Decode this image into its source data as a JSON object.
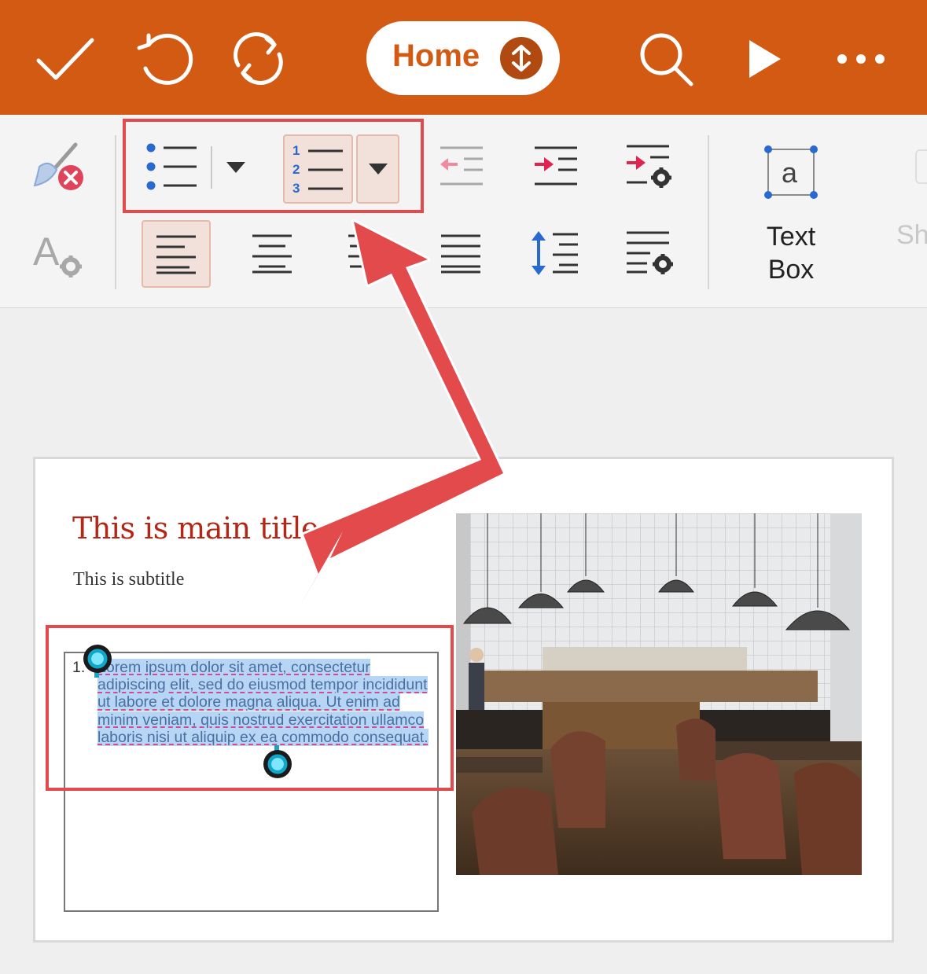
{
  "appbar": {
    "tab_label": "Home",
    "icons": [
      "checkmark-icon",
      "undo-icon",
      "redo-icon",
      "up-down-toggle-icon",
      "search-icon",
      "play-icon",
      "more-icon"
    ],
    "accent_color": "#d35a13"
  },
  "ribbon": {
    "groups": {
      "paragraph": [
        "bullets",
        "bullets-dropdown",
        "numbering",
        "numbering-dropdown",
        "decrease-indent",
        "increase-indent",
        "indent-options",
        "align-left",
        "align-center",
        "align-right",
        "justify",
        "line-spacing",
        "paragraph-options"
      ],
      "format": [
        "clear-formatting",
        "text-styles"
      ]
    },
    "text_box_label": "Text Box",
    "text_box_icon_letter": "a",
    "cut_off_label": "Sh",
    "numbering_digits": [
      "1",
      "2",
      "3"
    ]
  },
  "slide": {
    "title": "This is main title",
    "subtitle": "This is subtitle",
    "list_number": "1.",
    "body_text": "Lorem ipsum dolor sit amet, consectetur adipiscing elit, sed do eiusmod tempor incididunt ut labore et dolore magna aliqua. Ut enim ad minim veniam, quis nostrud exercitation ullamco laboris nisi ut aliquip ex ea commodo consequat."
  },
  "annotation": {
    "color": "#e34a4c"
  }
}
